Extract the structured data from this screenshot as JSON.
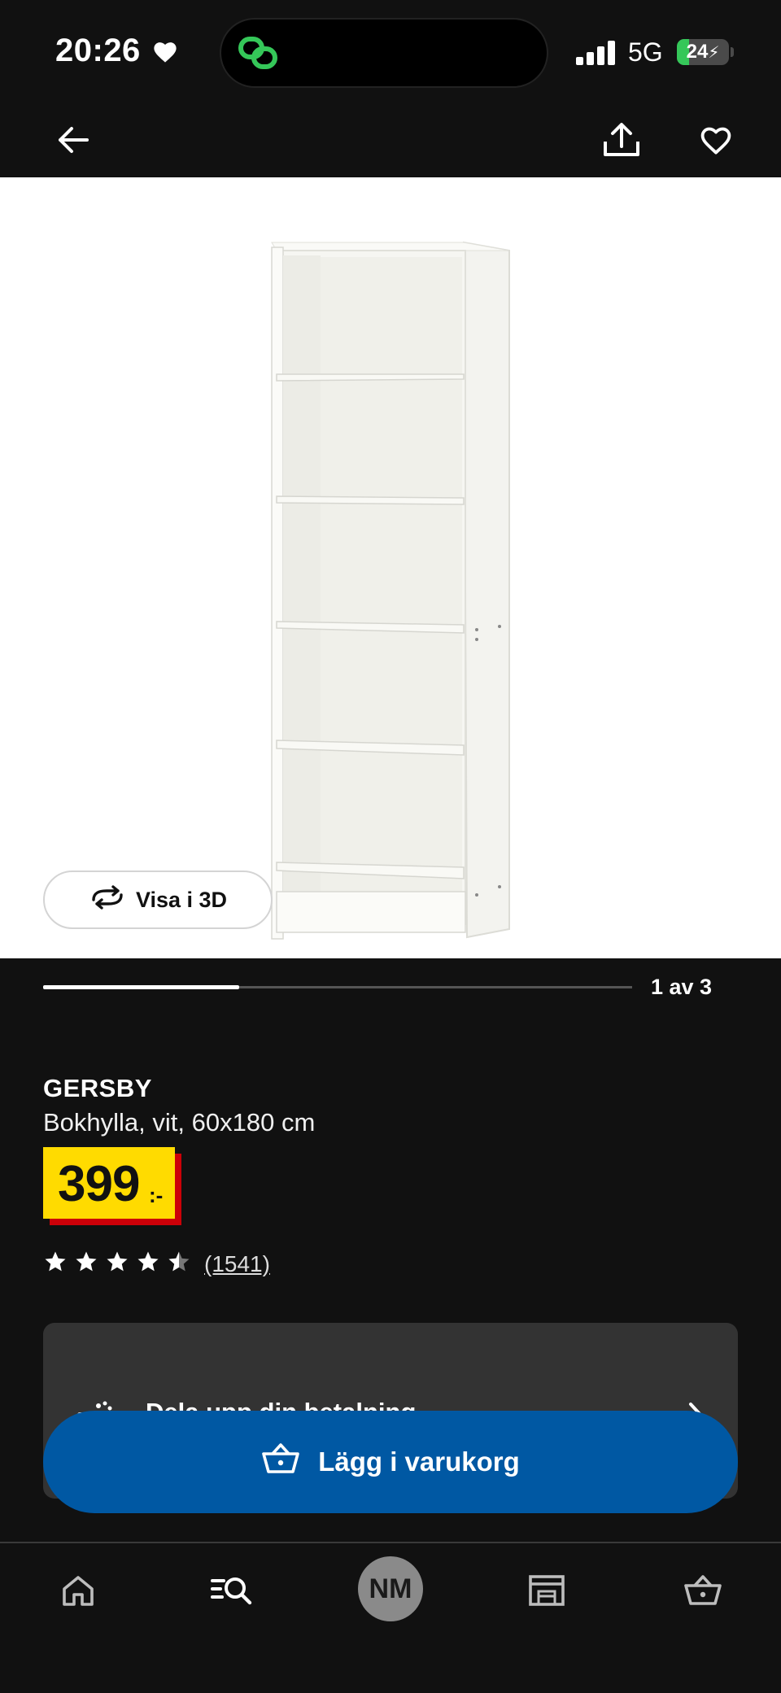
{
  "status_bar": {
    "time": "20:26",
    "network": "5G",
    "battery": "24",
    "battery_level": 0.24
  },
  "nav": {
    "back_icon": "arrow-left-icon",
    "share_icon": "share-icon",
    "favorite_icon": "heart-outline-icon"
  },
  "gallery": {
    "view_3d_label": "Visa i 3D",
    "counter": "1 av 3",
    "progress": 0.333
  },
  "product": {
    "name": "GERSBY",
    "description": "Bokhylla, vit, 60x180 cm",
    "price": "399",
    "price_suffix": ":-",
    "rating": 4.5,
    "review_count": "(1541)"
  },
  "payment_card": {
    "label": "Dela upp din betalning"
  },
  "cart_button": {
    "label": "Lägg i varukorg"
  },
  "tab_bar": {
    "items": [
      "home-icon",
      "search-icon",
      "profile-avatar",
      "store-icon",
      "cart-icon"
    ],
    "avatar_initials": "NM"
  },
  "colors": {
    "background": "#111111",
    "price_yellow": "#ffdb00",
    "price_red": "#cc0008",
    "primary_blue": "#0058a3",
    "battery_green": "#35c759"
  }
}
